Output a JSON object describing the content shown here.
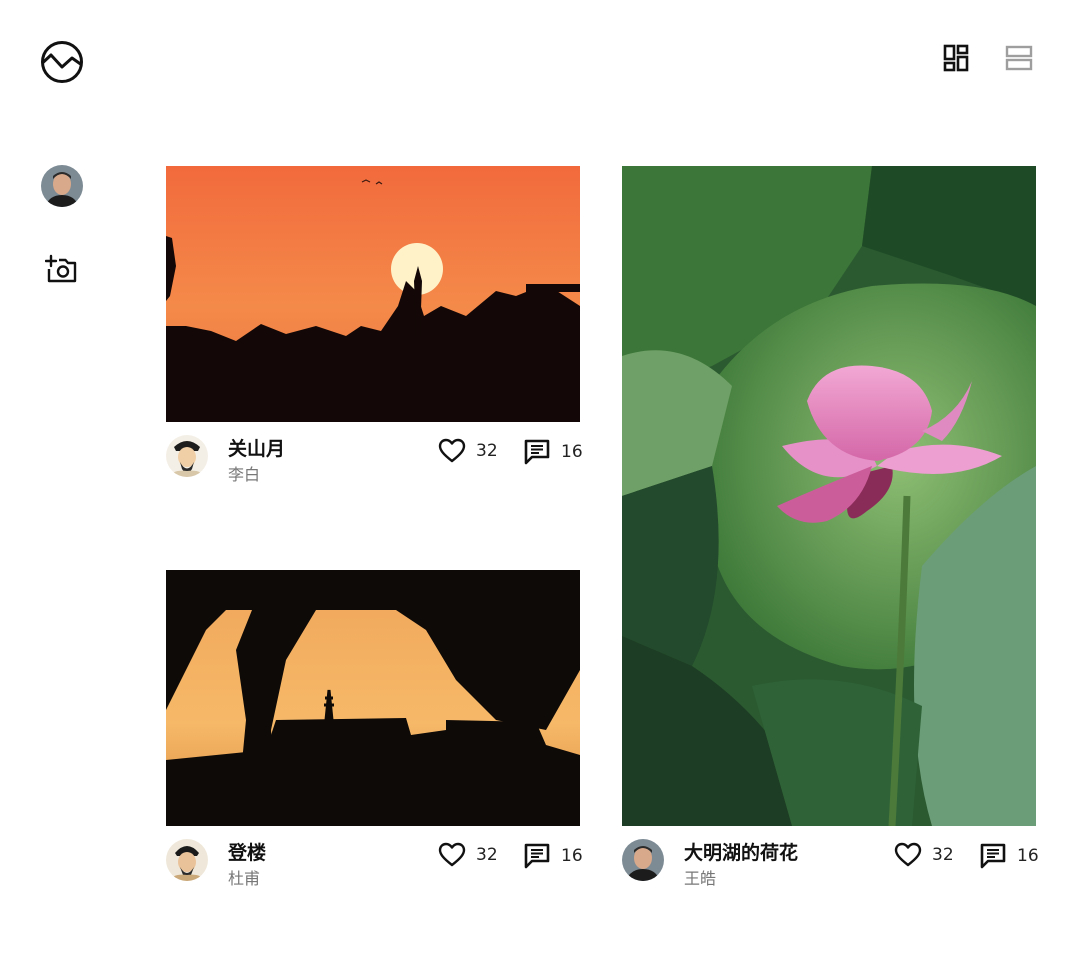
{
  "app": {
    "logo_icon": "wave-circle-logo-icon"
  },
  "toolbar": {
    "grid_view_icon": "grid-view-icon",
    "list_view_icon": "list-view-icon",
    "active_view": "grid"
  },
  "sidebar": {
    "avatar_icon": "user-avatar",
    "upload_icon": "add-photo-camera-icon"
  },
  "posts": [
    {
      "title": "关山月",
      "author": "李白",
      "likes": "32",
      "comments": "16",
      "photo": "sunset-silhouette"
    },
    {
      "title": "登楼",
      "author": "杜甫",
      "likes": "32",
      "comments": "16",
      "photo": "pagoda-sunset"
    },
    {
      "title": "大明湖的荷花",
      "author": "王皓",
      "likes": "32",
      "comments": "16",
      "photo": "lotus-flower"
    }
  ],
  "colors": {
    "like": "#111111",
    "muted": "#777777",
    "inactive_icon": "#9e9e9e"
  }
}
